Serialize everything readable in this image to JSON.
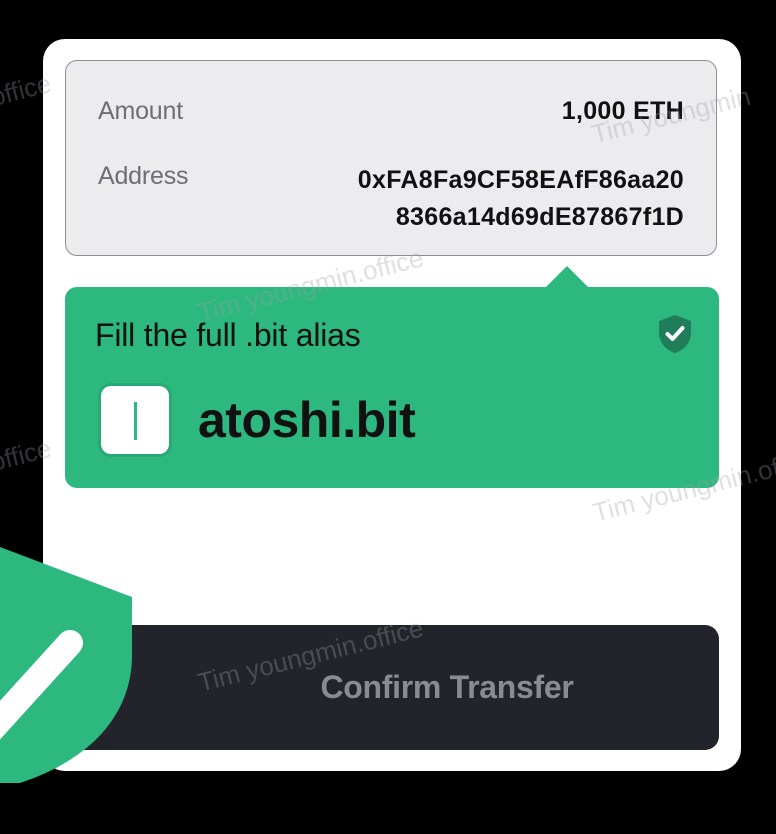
{
  "details": {
    "amount_label": "Amount",
    "amount_value": "1,000 ETH",
    "address_label": "Address",
    "address_line1": "0xFA8Fa9CF58EAfF86aa20",
    "address_line2": "8366a14d69dE87867f1D"
  },
  "alias": {
    "title": "Fill the full .bit alias",
    "value": "atoshi.bit",
    "badge_icon": "shield-check-icon"
  },
  "confirm": {
    "label": "Confirm Transfer"
  },
  "decoration": {
    "icon": "shield-check-icon"
  },
  "watermarks": [
    "Tim youngmin.office",
    "Tim youngmin.office",
    "Tim youngmin.office",
    "Tim youngmin.office",
    "office",
    "office",
    "Tim youngmin"
  ],
  "colors": {
    "accent": "#2db87f",
    "button_bg": "#23242b",
    "button_text": "#8a8b90",
    "details_bg": "#ececef"
  }
}
